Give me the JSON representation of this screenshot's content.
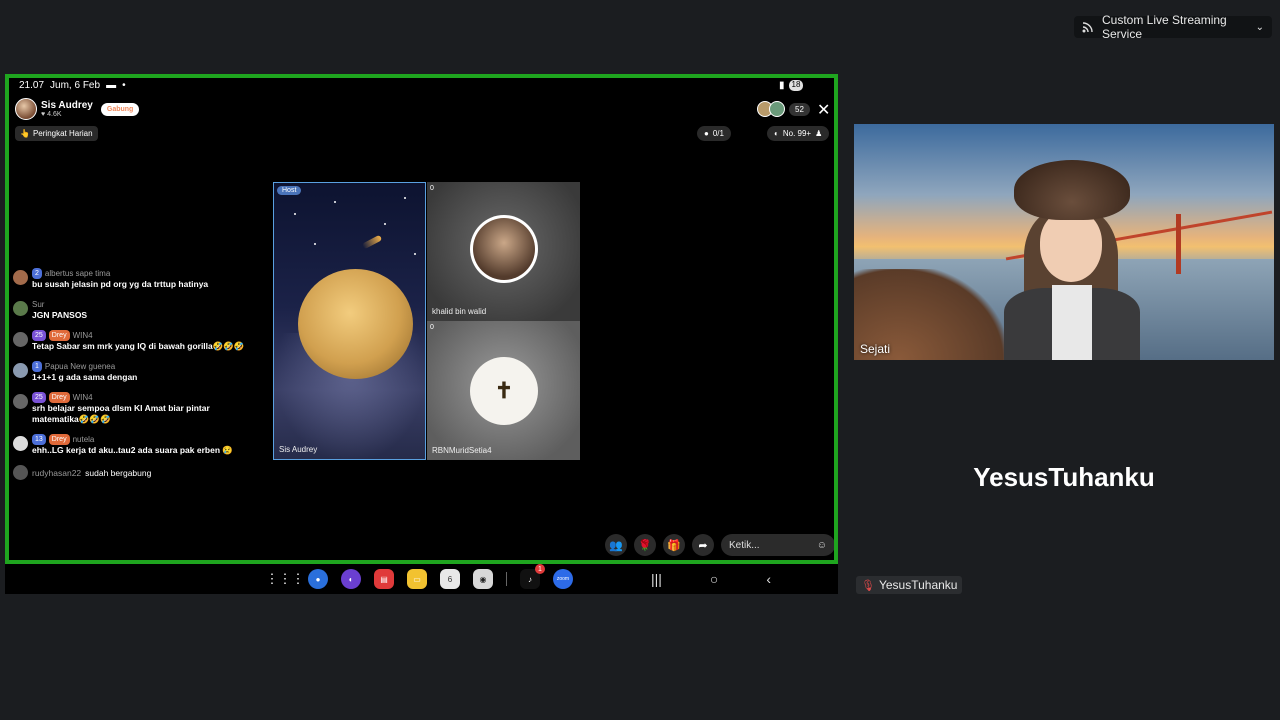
{
  "stream_badge": {
    "label": "Custom Live Streaming Service",
    "icon": "broadcast-icon"
  },
  "phone": {
    "time": "21.07",
    "date": "Jum, 6 Feb",
    "battery": "18",
    "host": {
      "name": "Sis Audrey",
      "followers": "♥ 4.6K",
      "join_label": "Gabung"
    },
    "viewer_count": "52",
    "rank_chip": "Peringkat Harian",
    "gift_progress": "0/1",
    "rank_no": "No. 99+",
    "tiles": {
      "host_badge": "Host",
      "host_label": "Sis Audrey",
      "khalid_count": "0",
      "khalid_label": "khalid bin walid",
      "rbn_count": "0",
      "rbn_label": "RBNMuridSetia4"
    },
    "chat": [
      {
        "user": "albertus sape tima",
        "level": "2",
        "tag": "",
        "text": "bu susah jelasin pd org yg da trttup hatinya"
      },
      {
        "user": "Sur",
        "level": "",
        "tag": "",
        "text": "JGN PANSOS"
      },
      {
        "user": "WIN4",
        "level": "25",
        "tag": "Drey",
        "text": "Tetap Sabar sm  mrk yang IQ di bawah gorilla🤣🤣🤣"
      },
      {
        "user": "Papua New guenea",
        "level": "1",
        "tag": "",
        "text": "1+1+1 g ada sama dengan"
      },
      {
        "user": "WIN4",
        "level": "25",
        "tag": "Drey",
        "text": "srh belajar sempoa dlsm KI Amat biar pintar matematika🤣🤣🤣"
      },
      {
        "user": "nutela",
        "level": "13",
        "tag": "Drey",
        "text": "ehh..LG kerja td aku..tau2 ada suara pak erben 😢"
      }
    ],
    "joined": {
      "user": "rudyhasan22",
      "text": "sudah bergabung"
    },
    "comment_placeholder": "Ketik..."
  },
  "dock_apps": [
    {
      "name": "messages",
      "color": "#2a6fdb"
    },
    {
      "name": "internet",
      "color": "#6a3fd0"
    },
    {
      "name": "notes",
      "color": "#e03a3a"
    },
    {
      "name": "files",
      "color": "#f2c230"
    },
    {
      "name": "calendar",
      "color": "#e8e8e8",
      "label": "6"
    },
    {
      "name": "camera",
      "color": "#d8d8d8"
    },
    {
      "name": "tiktok",
      "color": "#111111",
      "badge": "1"
    },
    {
      "name": "zoom",
      "color": "#2d6be8",
      "label": "zoom"
    }
  ],
  "webcam": {
    "label": "Sejati"
  },
  "participant": {
    "big_name": "YesusTuhanku",
    "tag_name": "YesusTuhanku"
  }
}
